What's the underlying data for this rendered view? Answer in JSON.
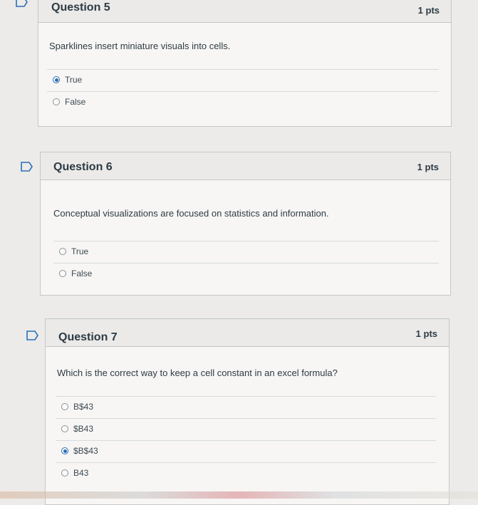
{
  "questions": [
    {
      "title": "Question 5",
      "points": "1 pts",
      "text": "Sparklines insert miniature visuals into cells.",
      "answers": [
        {
          "label": "True",
          "selected": true
        },
        {
          "label": "False",
          "selected": false
        }
      ]
    },
    {
      "title": "Question 6",
      "points": "1 pts",
      "text": "Conceptual visualizations are focused on statistics and information.",
      "answers": [
        {
          "label": "True",
          "selected": false
        },
        {
          "label": "False",
          "selected": false
        }
      ]
    },
    {
      "title": "Question 7",
      "points": "1 pts",
      "text": "Which is the correct way to keep a cell constant in an excel formula?",
      "answers": [
        {
          "label": "B$43",
          "selected": false
        },
        {
          "label": "$B43",
          "selected": false
        },
        {
          "label": "$B$43",
          "selected": true
        },
        {
          "label": "B43",
          "selected": false
        }
      ]
    }
  ],
  "colors": {
    "accent": "#2b6fb6",
    "flag": "#2b6fb6"
  },
  "icons": {
    "flag": "bookmark-flag-icon"
  }
}
